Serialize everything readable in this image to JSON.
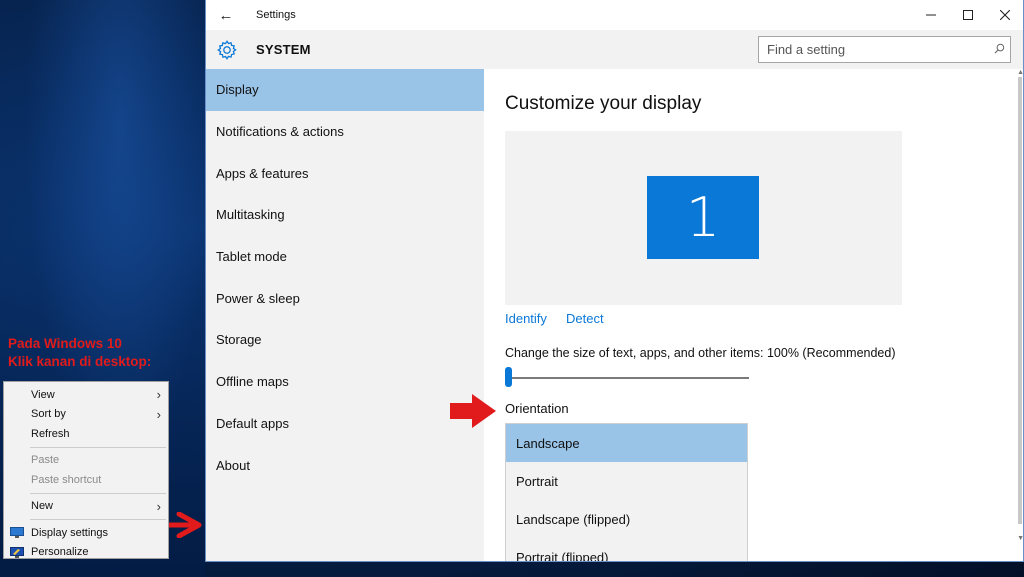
{
  "window": {
    "title": "Settings",
    "back_glyph": "←",
    "controls": {
      "minimize": "—",
      "maximize": "☐",
      "close": "✕"
    }
  },
  "header": {
    "section": "SYSTEM",
    "icon": "gear-icon",
    "search_placeholder": "Find a setting",
    "search_icon": "search-icon"
  },
  "sidebar": {
    "items": [
      {
        "label": "Display",
        "active": true
      },
      {
        "label": "Notifications & actions"
      },
      {
        "label": "Apps & features"
      },
      {
        "label": "Multitasking"
      },
      {
        "label": "Tablet mode"
      },
      {
        "label": "Power & sleep"
      },
      {
        "label": "Storage"
      },
      {
        "label": "Offline maps"
      },
      {
        "label": "Default apps"
      },
      {
        "label": "About"
      }
    ]
  },
  "main": {
    "title": "Customize your display",
    "monitor_number": "1",
    "identify_link": "Identify",
    "detect_link": "Detect",
    "scale_text": "Change the size of text, apps, and other items: 100% (Recommended)",
    "scale_value_percent": 100,
    "orientation_label": "Orientation",
    "orientation_options": [
      {
        "label": "Landscape",
        "selected": true
      },
      {
        "label": "Portrait"
      },
      {
        "label": "Landscape (flipped)"
      },
      {
        "label": "Portrait (flipped)"
      }
    ]
  },
  "annotation": {
    "line1": "Pada Windows 10",
    "line2": "Klik kanan di desktop:"
  },
  "context_menu": {
    "view": "View",
    "sort_by": "Sort by",
    "refresh": "Refresh",
    "paste": "Paste",
    "paste_shortcut": "Paste shortcut",
    "new": "New",
    "display_settings": "Display settings",
    "personalize": "Personalize"
  },
  "colors": {
    "accent": "#0a78d7",
    "selection": "#99c3e7",
    "panel": "#f2f2f2",
    "annotation_red": "#e11b1b"
  }
}
